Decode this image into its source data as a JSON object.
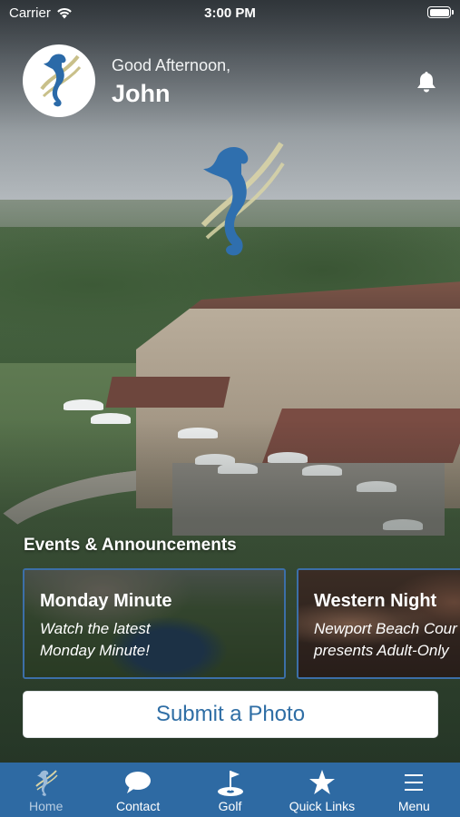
{
  "status_bar": {
    "carrier": "Carrier",
    "time": "3:00 PM"
  },
  "header": {
    "greeting": "Good Afternoon,",
    "username": "John"
  },
  "events": {
    "title": "Events & Announcements",
    "cards": [
      {
        "title": "Monday Minute",
        "description_line1": "Watch the latest",
        "description_line2": "Monday Minute!"
      },
      {
        "title": "Western Night",
        "description_line1": "Newport Beach Cour",
        "description_line2": "presents Adult-Only"
      }
    ]
  },
  "submit_button": {
    "label": "Submit a Photo"
  },
  "tabs": [
    {
      "label": "Home",
      "icon": "seahorse-icon",
      "active": true
    },
    {
      "label": "Contact",
      "icon": "chat-bubble-icon",
      "active": false
    },
    {
      "label": "Golf",
      "icon": "golf-flag-icon",
      "active": false
    },
    {
      "label": "Quick Links",
      "icon": "star-icon",
      "active": false
    },
    {
      "label": "Menu",
      "icon": "hamburger-menu-icon",
      "active": false
    }
  ],
  "colors": {
    "tabbar": "#2e6aa3",
    "accent_blue": "#2f6ea5",
    "card_border": "#3c6fa8",
    "logo_gold": "#c9c08a",
    "logo_blue": "#2b6aa8"
  }
}
